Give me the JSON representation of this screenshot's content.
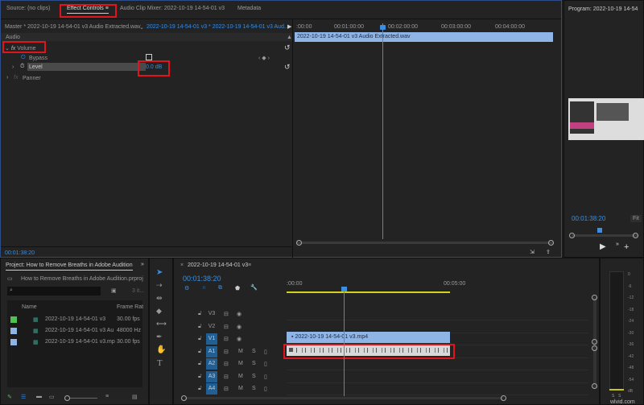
{
  "top_tabs": {
    "source": "Source: (no clips)",
    "effect_controls": "Effect Controls",
    "menu_icon": "≡",
    "audio_clip_mixer": "Audio Clip Mixer: 2022-10-19 14-54-01 v3",
    "metadata": "Metadata"
  },
  "effect_controls": {
    "master": "Master * 2022-10-19 14-54-01 v3 Audio Extracted.wav",
    "clip": "2022-10-19 14-54-01 v3 * 2022-10-19 14-54-01 v3 Aud...",
    "section": "Audio",
    "volume": "Volume",
    "bypass": "Bypass",
    "level": "Level",
    "level_value": "0.0",
    "level_unit": "dB",
    "panner": "Panner",
    "fx": "fx",
    "timecode": "00:01:38:20",
    "ruler": [
      ":00:00",
      "00:01:00:00",
      "00:02:00:00",
      "00:03:00:00",
      "00:04:00:00"
    ],
    "clip_bar": "2022-10-19 14-54-01 v3 Audio Extracted.wav"
  },
  "program": {
    "title": "Program: 2022-10-19 14-54",
    "timecode": "00:01:38:20",
    "fit": "Fit"
  },
  "project": {
    "title": "Project: How to Remove Breaths in Adobe Audition",
    "file": "How to Remove Breaths in Adobe Audition.prproj",
    "count": "3 it...",
    "columns": [
      "Name",
      "Frame Rat"
    ],
    "items": [
      {
        "name": "2022-10-19 14-54-01 v3",
        "rate": "30.00 fps",
        "color": "#4fc14f",
        "icon": "sequence-icon"
      },
      {
        "name": "2022-10-19 14-54-01 v3 Au",
        "rate": "48000 Hz",
        "color": "#8fb4e6",
        "icon": "audio-clip-icon"
      },
      {
        "name": "2022-10-19 14-54-01 v3.mp",
        "rate": "30.00 fps",
        "color": "#8fb4e6",
        "icon": "video-clip-icon"
      }
    ]
  },
  "timeline": {
    "sequence": "2022-10-19 14-54-01 v3",
    "timecode": "00:01:38:20",
    "ruler": [
      ":00:00",
      "00:05:00"
    ],
    "video_tracks": [
      "V3",
      "V2",
      "V1"
    ],
    "audio_tracks": [
      "A1",
      "A2",
      "A3",
      "A4"
    ],
    "video_clip": "2022-10-19 14-54-01 v3.mp4",
    "m": "M",
    "s": "S"
  },
  "meters": {
    "scale": [
      "0",
      "-6",
      "-12",
      "-18",
      "-24",
      "-30",
      "-36",
      "-42",
      "-48",
      "-54",
      "dB"
    ],
    "bottom": [
      "S",
      "S"
    ]
  },
  "watermark": "wlvid.com"
}
